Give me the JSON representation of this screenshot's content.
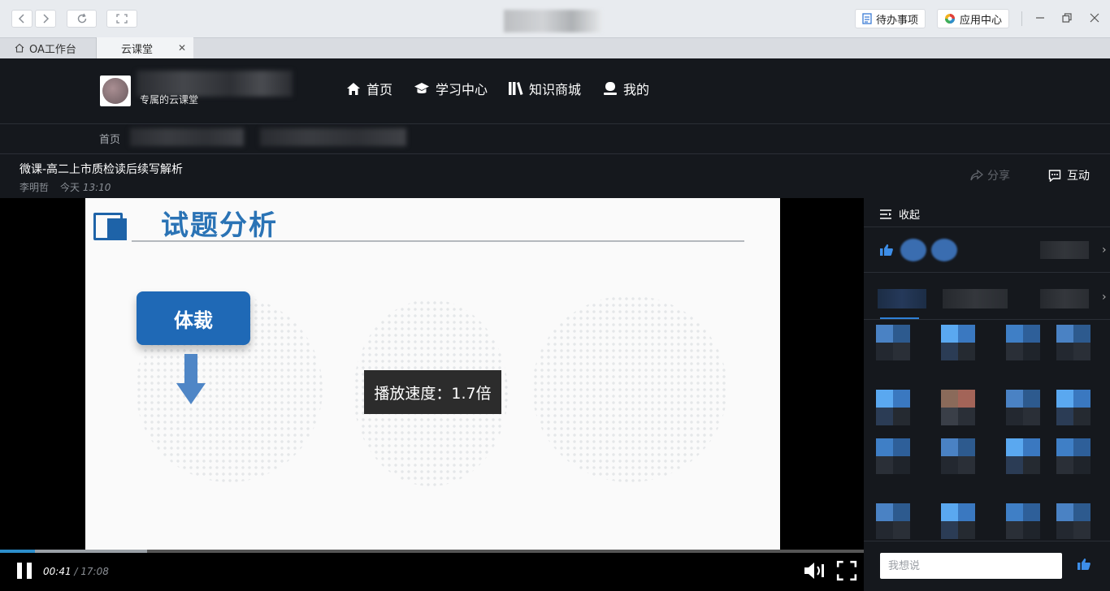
{
  "browser": {
    "back_icon": "chevron-left-icon",
    "forward_icon": "chevron-right-icon",
    "todo_label": "待办事项",
    "app_center_label": "应用中心"
  },
  "tabs": [
    {
      "label": "OA工作台",
      "icon": "home-icon"
    },
    {
      "label": "云课堂",
      "close": "✕"
    }
  ],
  "header": {
    "brand_subtitle": "专属的云课堂",
    "nav": [
      {
        "label": "首页",
        "icon": "home-icon"
      },
      {
        "label": "学习中心",
        "icon": "graduation-cap-icon"
      },
      {
        "label": "知识商城",
        "icon": "books-icon"
      },
      {
        "label": "我的",
        "icon": "user-icon"
      }
    ],
    "breadcrumb_home": "首页"
  },
  "video": {
    "title": "微课-高二上市质检读后续写解析",
    "author": "李明哲",
    "date_label": "今天",
    "time": "13:10",
    "share_label": "分享",
    "interact_label": "互动"
  },
  "slide": {
    "title": "试题分析",
    "tag": "体裁"
  },
  "player": {
    "speed_tip": "播放速度：1.7倍",
    "current_time": "00:41",
    "separator": " / ",
    "duration": "17:08",
    "progress": 0.04,
    "buffered": 0.17
  },
  "sidebar": {
    "collapse_label": "收起",
    "comment_placeholder": "我想说"
  },
  "colors": {
    "accent": "#2c8ecb",
    "like_blue": "#3d8ee8",
    "slide_blue": "#1f69b6"
  }
}
